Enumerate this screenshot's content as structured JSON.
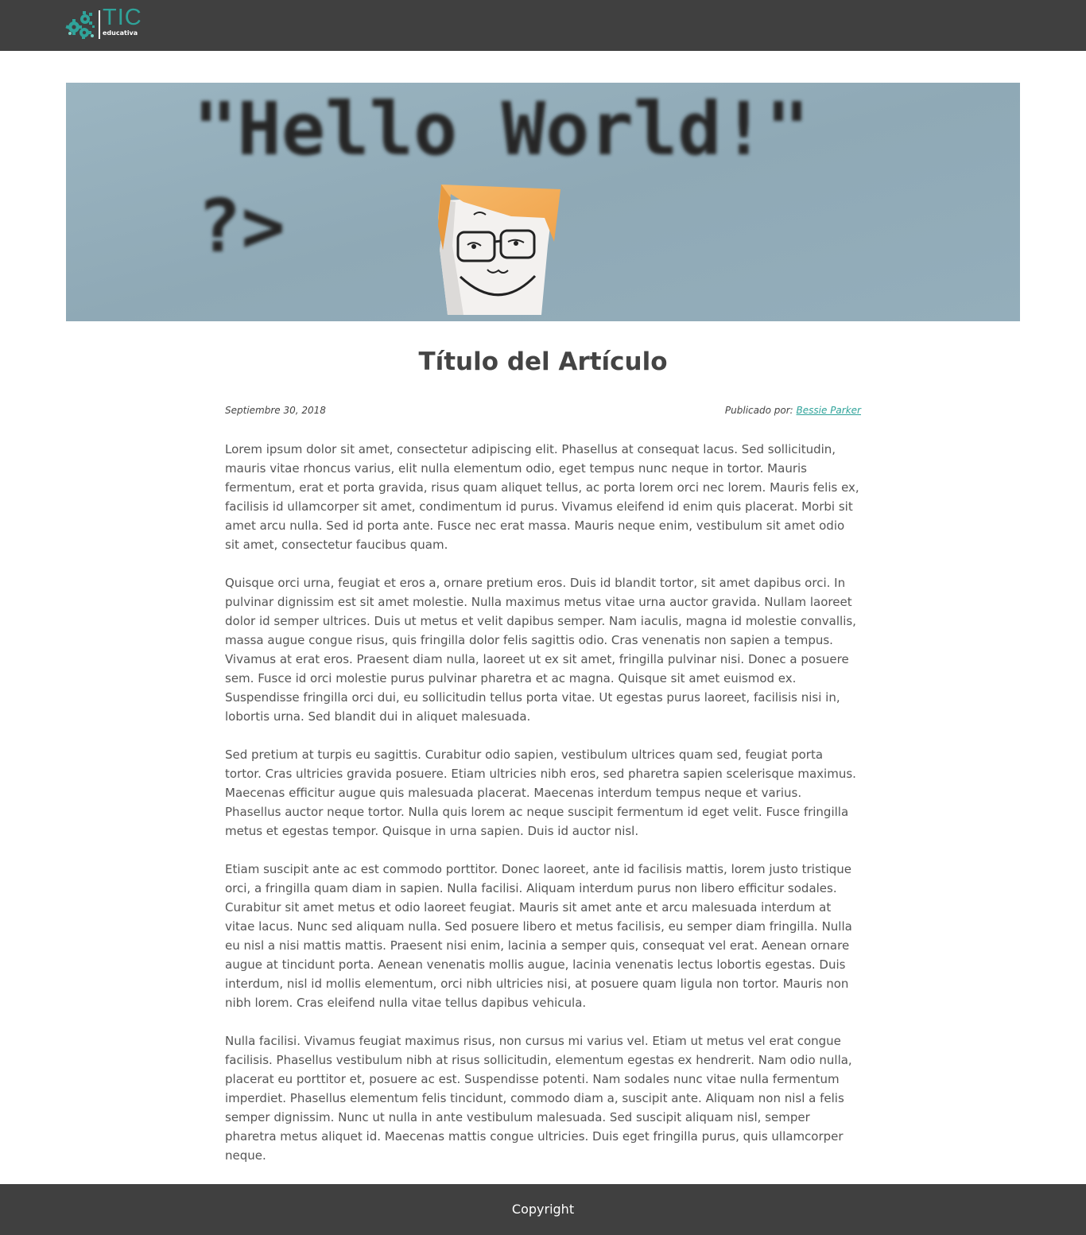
{
  "header": {
    "logo": {
      "brand": "TIC",
      "tagline": "educativa"
    }
  },
  "hero": {
    "code_text": "\"Hello World!\"",
    "code_suffix": "?>"
  },
  "article": {
    "title": "Título del Artículo",
    "date": "Septiembre 30, 2018",
    "published_by_label": "Publicado por:",
    "author": "Bessie Parker",
    "paragraphs": [
      "Lorem ipsum dolor sit amet, consectetur adipiscing elit. Phasellus at consequat lacus. Sed sollicitudin, mauris vitae rhoncus varius, elit nulla elementum odio, eget tempus nunc neque in tortor. Mauris fermentum, erat et porta gravida, risus quam aliquet tellus, ac porta lorem orci nec lorem. Mauris felis ex, facilisis id ullamcorper sit amet, condimentum id purus. Vivamus eleifend id enim quis placerat. Morbi sit amet arcu nulla. Sed id porta ante. Fusce nec erat massa. Mauris neque enim, vestibulum sit amet odio sit amet, consectetur faucibus quam.",
      "Quisque orci urna, feugiat et eros a, ornare pretium eros. Duis id blandit tortor, sit amet dapibus orci. In pulvinar dignissim est sit amet molestie. Nulla maximus metus vitae urna auctor gravida. Nullam laoreet dolor id semper ultrices. Duis ut metus et velit dapibus semper. Nam iaculis, magna id molestie convallis, massa augue congue risus, quis fringilla dolor felis sagittis odio. Cras venenatis non sapien a tempus. Vivamus at erat eros. Praesent diam nulla, laoreet ut ex sit amet, fringilla pulvinar nisi. Donec a posuere sem. Fusce id orci molestie purus pulvinar pharetra et ac magna. Quisque sit amet euismod ex. Suspendisse fringilla orci dui, eu sollicitudin tellus porta vitae. Ut egestas purus laoreet, facilisis nisi in, lobortis urna. Sed blandit dui in aliquet malesuada.",
      "Sed pretium at turpis eu sagittis. Curabitur odio sapien, vestibulum ultrices quam sed, feugiat porta tortor. Cras ultricies gravida posuere. Etiam ultricies nibh eros, sed pharetra sapien scelerisque maximus. Maecenas efficitur augue quis malesuada placerat. Maecenas interdum tempus neque et varius. Phasellus auctor neque tortor. Nulla quis lorem ac neque suscipit fermentum id eget velit. Fusce fringilla metus et egestas tempor. Quisque in urna sapien. Duis id auctor nisl.",
      "Etiam suscipit ante ac est commodo porttitor. Donec laoreet, ante id facilisis mattis, lorem justo tristique orci, a fringilla quam diam in sapien. Nulla facilisi. Aliquam interdum purus non libero efficitur sodales. Curabitur sit amet metus et odio laoreet feugiat. Mauris sit amet ante et arcu malesuada interdum at vitae lacus. Nunc sed aliquam nulla. Sed posuere libero et metus facilisis, eu semper diam fringilla. Nulla eu nisl a nisi mattis mattis. Praesent nisi enim, lacinia a semper quis, consequat vel erat. Aenean ornare augue at tincidunt porta. Aenean venenatis mollis augue, lacinia venenatis lectus lobortis egestas. Duis interdum, nisl id mollis elementum, orci nibh ultricies nisi, at posuere quam ligula non tortor. Mauris non nibh lorem. Cras eleifend nulla vitae tellus dapibus vehicula.",
      "Nulla facilisi. Vivamus feugiat maximus risus, non cursus mi varius vel. Etiam ut metus vel erat congue facilisis. Phasellus vestibulum nibh at risus sollicitudin, elementum egestas ex hendrerit. Nam odio nulla, placerat eu porttitor et, posuere ac est. Suspendisse potenti. Nam sodales nunc vitae nulla fermentum imperdiet. Phasellus elementum felis tincidunt, commodo diam a, suscipit ante. Aliquam non nisl a felis semper dignissim. Nunc ut nulla in ante vestibulum malesuada. Sed suscipit aliquam nisl, semper pharetra metus aliquet id. Maecenas mattis congue ultricies. Duis eget fringilla purus, quis ullamcorper neque."
    ]
  },
  "footer": {
    "text": "Copyright"
  },
  "colors": {
    "header_bg": "#404040",
    "accent": "#2fa39a",
    "text": "#555555",
    "title": "#444444",
    "hero_bg": "#93adb9"
  }
}
